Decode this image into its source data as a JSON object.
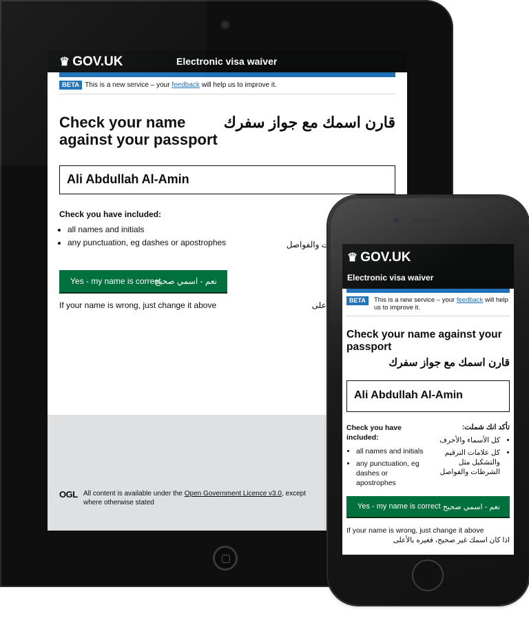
{
  "tablet": {
    "header": {
      "logo_text": "GOV.UK",
      "service_name": "Electronic visa waiver"
    },
    "beta": {
      "tag": "BETA",
      "text_before": "This is a new service – your ",
      "link": "feedback",
      "text_after": " will help us to improve it."
    },
    "title_en": "Check your name against your passport",
    "title_ar": "قارن اسمك مع جواز سفرك",
    "name_value": "Ali Abdullah Al-Amin",
    "check": {
      "heading": "Check you have included:",
      "items": [
        "all names and initials",
        "any punctuation, eg dashes or apostrophes"
      ],
      "ar_partial": "التشكيل مثل الشرطات والفواصل",
      "ar_partial_top": ":"
    },
    "button": {
      "label_en": "Yes - my name is correct",
      "label_ar": "نعم - اسمي صحيح"
    },
    "wrong_en": "If your name is wrong, just change it above",
    "wrong_ar": "ح، فغيره بالأعلى",
    "footer": {
      "ogl": "OGL",
      "text_before": "All content is available under the ",
      "link": "Open Government Licence v3.0",
      "text_after": ", except where otherwise stated"
    }
  },
  "phone": {
    "header": {
      "logo_text": "GOV.UK",
      "service_name": "Electronic visa waiver"
    },
    "beta": {
      "tag": "BETA",
      "text_before": "This is a new service – your ",
      "link": "feedback",
      "text_after": " will help us to improve it."
    },
    "title_en": "Check your name against your passport",
    "title_ar": "قارن اسمك مع جواز سفرك",
    "name_value": "Ali Abdullah Al-Amin",
    "check_en": {
      "heading": "Check you have included:",
      "items": [
        "all names and initials",
        "any punctuation, eg dashes or apostrophes"
      ]
    },
    "check_ar": {
      "heading": "تأكد انك شملت:",
      "items": [
        "كل الأسماء والأحرف",
        "كل علامات الترقيم والتشكيل مثل الشرطات والفواصل"
      ]
    },
    "button": {
      "label_en": "Yes - my name is correct",
      "label_ar": "نعم - اسمي صحيح"
    },
    "wrong_en": "If your name is wrong, just change it above",
    "wrong_ar": "اذا كان اسمك غير صحيح، فغيره بالأعلى"
  }
}
